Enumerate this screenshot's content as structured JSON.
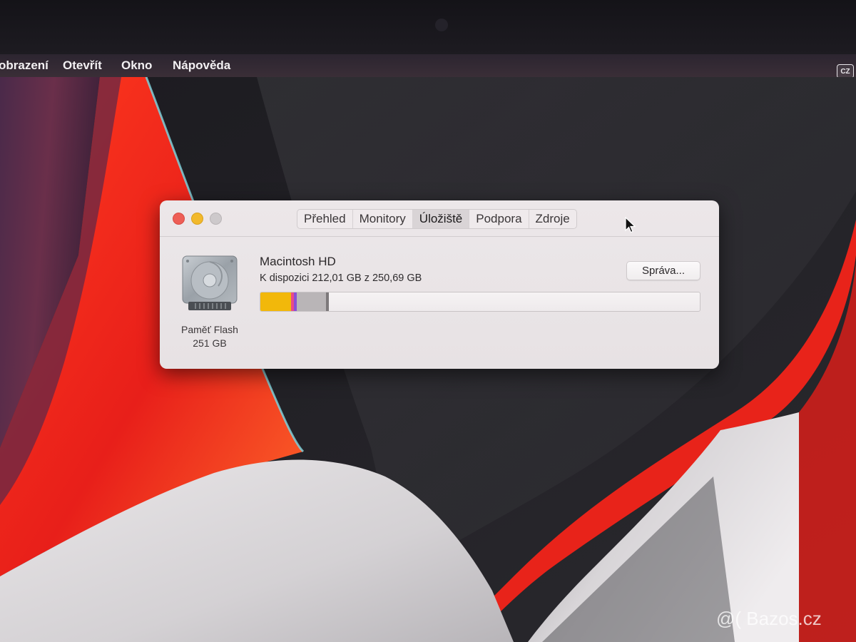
{
  "menubar": {
    "items": [
      "obrazení",
      "Otevřít",
      "Okno",
      "Nápověda"
    ],
    "input_source": "CZ"
  },
  "window": {
    "tabs": [
      {
        "label": "Přehled",
        "active": false
      },
      {
        "label": "Monitory",
        "active": false
      },
      {
        "label": "Úložiště",
        "active": true
      },
      {
        "label": "Podpora",
        "active": false
      },
      {
        "label": "Zdroje",
        "active": false
      }
    ],
    "disk": {
      "type_label": "Paměť Flash",
      "capacity_label": "251 GB",
      "name": "Macintosh HD",
      "available_text": "K dispozici 212,01 GB z 250,69 GB",
      "manage_label": "Správa..."
    },
    "storage_usage": {
      "total_gb": 250.69,
      "available_gb": 212.01,
      "segments": [
        {
          "category": "apps",
          "fraction": 0.07,
          "color": "#f2b80a"
        },
        {
          "category": "documents",
          "fraction": 0.007,
          "color": "#e84a8a"
        },
        {
          "category": "other-1",
          "fraction": 0.007,
          "color": "#8a4fd6"
        },
        {
          "category": "system",
          "fraction": 0.066,
          "color": "#b9b5b7"
        },
        {
          "category": "other-2",
          "fraction": 0.006,
          "color": "#7d797b"
        }
      ]
    }
  },
  "watermark": "@( Bazos.cz",
  "colors": {
    "accent_close": "#ee5e56",
    "accent_minimize": "#f2b92c",
    "wallpaper_red": "#e8231a"
  }
}
